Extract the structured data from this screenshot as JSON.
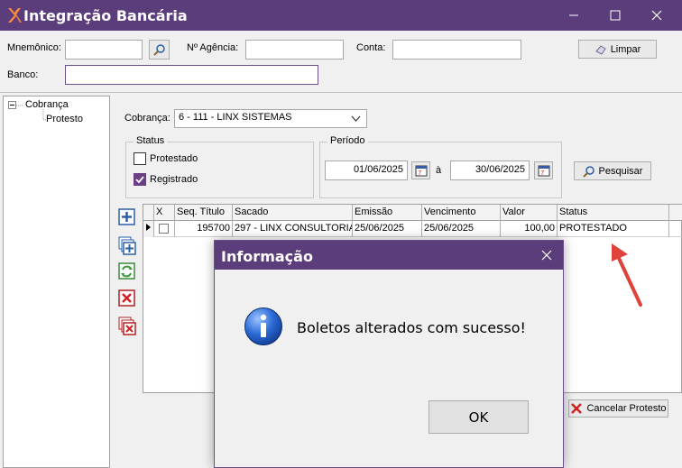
{
  "window": {
    "title": "Integração Bancária"
  },
  "filters": {
    "mnemonico_label": "Mnemônico:",
    "agencia_label": "Nº Agência:",
    "conta_label": "Conta:",
    "banco_label": "Banco:",
    "mnemonico_value": "",
    "agencia_value": "",
    "conta_value": "",
    "banco_value": "",
    "limpar_label": "Limpar"
  },
  "tree": {
    "root": "Cobrança",
    "child": "Protesto"
  },
  "cobranca": {
    "label": "Cobrança:",
    "value": "6 - 111 - LINX SISTEMAS"
  },
  "status_group": {
    "title": "Status",
    "protestado": "Protestado",
    "registrado": "Registrado"
  },
  "periodo": {
    "title": "Período",
    "start": "01/06/2025",
    "sep": "à",
    "end": "30/06/2025"
  },
  "pesquisar_label": "Pesquisar",
  "grid": {
    "columns": [
      "X",
      "Seq. Título",
      "Sacado",
      "Emissão",
      "Vencimento",
      "Valor",
      "Status"
    ],
    "rows": [
      {
        "seq": "195700",
        "sacado": "297 - LINX CONSULTORIA",
        "emissao": "25/06/2025",
        "vencimento": "25/06/2025",
        "valor": "100,00",
        "status": "PROTESTADO"
      }
    ]
  },
  "cancelar_label": "Cancelar Protesto",
  "dialog": {
    "title": "Informação",
    "message": "Boletos alterados com sucesso!",
    "ok": "OK"
  },
  "colors": {
    "titlebar": "#5a3d7a",
    "arrow": "#e0413a"
  }
}
